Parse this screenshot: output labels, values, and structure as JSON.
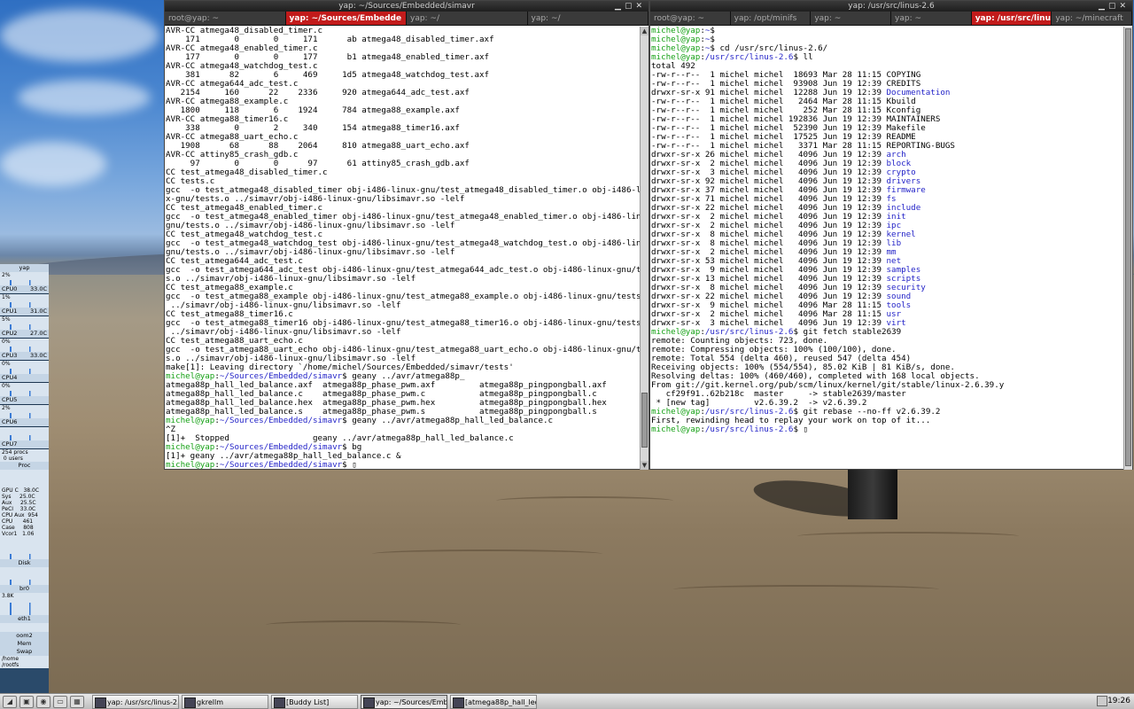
{
  "left_window": {
    "title": "yap: ~/Sources/Embedded/simavr",
    "tabs": [
      {
        "label": "root@yap: ~",
        "active": false
      },
      {
        "label": "yap: ~/Sources/Embedde",
        "active": true
      },
      {
        "label": "yap: ~/",
        "active": false
      },
      {
        "label": "yap: ~/",
        "active": false
      }
    ],
    "lines": [
      "AVR-CC atmega48_disabled_timer.c",
      "    171       0       0     171      ab atmega48_disabled_timer.axf",
      "AVR-CC atmega48_enabled_timer.c",
      "    177       0       0     177      b1 atmega48_enabled_timer.axf",
      "AVR-CC atmega48_watchdog_test.c",
      "    381      82       6     469     1d5 atmega48_watchdog_test.axf",
      "AVR-CC atmega644_adc_test.c",
      "   2154     160      22    2336     920 atmega644_adc_test.axf",
      "AVR-CC atmega88_example.c",
      "   1800     118       6    1924     784 atmega88_example.axf",
      "AVR-CC atmega88_timer16.c",
      "    338       0       2     340     154 atmega88_timer16.axf",
      "AVR-CC atmega88_uart_echo.c",
      "   1908      68      88    2064     810 atmega88_uart_echo.axf",
      "AVR-CC attiny85_crash_gdb.c",
      "     97       0       0      97      61 attiny85_crash_gdb.axf",
      "CC test_atmega48_disabled_timer.c",
      "CC tests.c",
      "gcc  -o test_atmega48_disabled_timer obj-i486-linux-gnu/test_atmega48_disabled_timer.o obj-i486-linu",
      "x-gnu/tests.o ../simavr/obj-i486-linux-gnu/libsimavr.so -lelf",
      "CC test_atmega48_enabled_timer.c",
      "gcc  -o test_atmega48_enabled_timer obj-i486-linux-gnu/test_atmega48_enabled_timer.o obj-i486-linux-",
      "gnu/tests.o ../simavr/obj-i486-linux-gnu/libsimavr.so -lelf",
      "CC test_atmega48_watchdog_test.c",
      "gcc  -o test_atmega48_watchdog_test obj-i486-linux-gnu/test_atmega48_watchdog_test.o obj-i486-linux-",
      "gnu/tests.o ../simavr/obj-i486-linux-gnu/libsimavr.so -lelf",
      "CC test_atmega644_adc_test.c",
      "gcc  -o test_atmega644_adc_test obj-i486-linux-gnu/test_atmega644_adc_test.o obj-i486-linux-gnu/test",
      "s.o ../simavr/obj-i486-linux-gnu/libsimavr.so -lelf",
      "CC test_atmega88_example.c",
      "gcc  -o test_atmega88_example obj-i486-linux-gnu/test_atmega88_example.o obj-i486-linux-gnu/tests.o",
      " ../simavr/obj-i486-linux-gnu/libsimavr.so -lelf",
      "CC test_atmega88_timer16.c",
      "gcc  -o test_atmega88_timer16 obj-i486-linux-gnu/test_atmega88_timer16.o obj-i486-linux-gnu/tests.o",
      " ../simavr/obj-i486-linux-gnu/libsimavr.so -lelf",
      "CC test_atmega88_uart_echo.c",
      "gcc  -o test_atmega88_uart_echo obj-i486-linux-gnu/test_atmega88_uart_echo.o obj-i486-linux-gnu/test",
      "s.o ../simavr/obj-i486-linux-gnu/libsimavr.so -lelf",
      "make[1]: Leaving directory `/home/michel/Sources/Embedded/simavr/tests'"
    ],
    "prompt_user": "michel@yap",
    "prompt_path": "~/Sources/Embedded/simavr",
    "cmd1": "geany ../avr/atmega88p_",
    "listing": [
      "atmega88p_hall_led_balance.axf  atmega88p_phase_pwm.axf         atmega88p_pingpongball.axf",
      "atmega88p_hall_led_balance.c    atmega88p_phase_pwm.c           atmega88p_pingpongball.c",
      "atmega88p_hall_led_balance.hex  atmega88p_phase_pwm.hex         atmega88p_pingpongball.hex",
      "atmega88p_hall_led_balance.s    atmega88p_phase_pwm.s           atmega88p_pingpongball.s"
    ],
    "cmd2": "geany ../avr/atmega88p_hall_led_balance.c",
    "after": [
      "^Z",
      "[1]+  Stopped                 geany ../avr/atmega88p_hall_led_balance.c"
    ],
    "cmd3": "bg",
    "bg_line": "[1]+ geany ../avr/atmega88p_hall_led_balance.c &"
  },
  "right_window": {
    "title": "yap: /usr/src/linus-2.6",
    "tabs": [
      {
        "label": "root@yap: ~",
        "active": false
      },
      {
        "label": "yap: /opt/minifs",
        "active": false
      },
      {
        "label": "yap: ~",
        "active": false
      },
      {
        "label": "yap: ~",
        "active": false
      },
      {
        "label": "yap: /usr/src/linus-2.6",
        "active": true
      },
      {
        "label": "yap: ~/minecraft",
        "active": false
      }
    ],
    "prompt_user": "michel@yap",
    "home_path": "~",
    "src_path": "/usr/src/linus-2.6",
    "cmd_cd": "cd /usr/src/linus-2.6/",
    "cmd_ll": "ll",
    "total": "total 492",
    "files": [
      {
        "meta": "-rw-r--r--  1 michel michel  18693 Mar 28 11:15 ",
        "name": "COPYING",
        "dir": false
      },
      {
        "meta": "-rw-r--r--  1 michel michel  93908 Jun 19 12:39 ",
        "name": "CREDITS",
        "dir": false
      },
      {
        "meta": "drwxr-sr-x 91 michel michel  12288 Jun 19 12:39 ",
        "name": "Documentation",
        "dir": true
      },
      {
        "meta": "-rw-r--r--  1 michel michel   2464 Mar 28 11:15 ",
        "name": "Kbuild",
        "dir": false
      },
      {
        "meta": "-rw-r--r--  1 michel michel    252 Mar 28 11:15 ",
        "name": "Kconfig",
        "dir": false
      },
      {
        "meta": "-rw-r--r--  1 michel michel 192836 Jun 19 12:39 ",
        "name": "MAINTAINERS",
        "dir": false
      },
      {
        "meta": "-rw-r--r--  1 michel michel  52390 Jun 19 12:39 ",
        "name": "Makefile",
        "dir": false
      },
      {
        "meta": "-rw-r--r--  1 michel michel  17525 Jun 19 12:39 ",
        "name": "README",
        "dir": false
      },
      {
        "meta": "-rw-r--r--  1 michel michel   3371 Mar 28 11:15 ",
        "name": "REPORTING-BUGS",
        "dir": false
      },
      {
        "meta": "drwxr-sr-x 26 michel michel   4096 Jun 19 12:39 ",
        "name": "arch",
        "dir": true
      },
      {
        "meta": "drwxr-sr-x  2 michel michel   4096 Jun 19 12:39 ",
        "name": "block",
        "dir": true
      },
      {
        "meta": "drwxr-sr-x  3 michel michel   4096 Jun 19 12:39 ",
        "name": "crypto",
        "dir": true
      },
      {
        "meta": "drwxr-sr-x 92 michel michel   4096 Jun 19 12:39 ",
        "name": "drivers",
        "dir": true
      },
      {
        "meta": "drwxr-sr-x 37 michel michel   4096 Jun 19 12:39 ",
        "name": "firmware",
        "dir": true
      },
      {
        "meta": "drwxr-sr-x 71 michel michel   4096 Jun 19 12:39 ",
        "name": "fs",
        "dir": true
      },
      {
        "meta": "drwxr-sr-x 22 michel michel   4096 Jun 19 12:39 ",
        "name": "include",
        "dir": true
      },
      {
        "meta": "drwxr-sr-x  2 michel michel   4096 Jun 19 12:39 ",
        "name": "init",
        "dir": true
      },
      {
        "meta": "drwxr-sr-x  2 michel michel   4096 Jun 19 12:39 ",
        "name": "ipc",
        "dir": true
      },
      {
        "meta": "drwxr-sr-x  8 michel michel   4096 Jun 19 12:39 ",
        "name": "kernel",
        "dir": true
      },
      {
        "meta": "drwxr-sr-x  8 michel michel   4096 Jun 19 12:39 ",
        "name": "lib",
        "dir": true
      },
      {
        "meta": "drwxr-sr-x  2 michel michel   4096 Jun 19 12:39 ",
        "name": "mm",
        "dir": true
      },
      {
        "meta": "drwxr-sr-x 53 michel michel   4096 Jun 19 12:39 ",
        "name": "net",
        "dir": true
      },
      {
        "meta": "drwxr-sr-x  9 michel michel   4096 Jun 19 12:39 ",
        "name": "samples",
        "dir": true
      },
      {
        "meta": "drwxr-sr-x 13 michel michel   4096 Jun 19 12:39 ",
        "name": "scripts",
        "dir": true
      },
      {
        "meta": "drwxr-sr-x  8 michel michel   4096 Jun 19 12:39 ",
        "name": "security",
        "dir": true
      },
      {
        "meta": "drwxr-sr-x 22 michel michel   4096 Jun 19 12:39 ",
        "name": "sound",
        "dir": true
      },
      {
        "meta": "drwxr-sr-x  9 michel michel   4096 Mar 28 11:15 ",
        "name": "tools",
        "dir": true
      },
      {
        "meta": "drwxr-sr-x  2 michel michel   4096 Mar 28 11:15 ",
        "name": "usr",
        "dir": true
      },
      {
        "meta": "drwxr-sr-x  3 michel michel   4096 Jun 19 12:39 ",
        "name": "virt",
        "dir": true
      }
    ],
    "cmd_fetch": "git fetch stable2639",
    "fetch_out": [
      "remote: Counting objects: 723, done.",
      "remote: Compressing objects: 100% (100/100), done.",
      "remote: Total 554 (delta 460), reused 547 (delta 454)",
      "Receiving objects: 100% (554/554), 85.02 KiB | 81 KiB/s, done.",
      "Resolving deltas: 100% (460/460), completed with 168 local objects.",
      "From git://git.kernel.org/pub/scm/linux/kernel/git/stable/linux-2.6.39.y",
      "   cf29f91..62b218c  master     -> stable2639/master",
      " * [new tag]         v2.6.39.2  -> v2.6.39.2"
    ],
    "cmd_rebase": "git rebase --no-ff v2.6.39.2",
    "rebase_out": "First, rewinding head to replay your work on top of it..."
  },
  "gkrellm": {
    "host": "yap",
    "cpus": [
      {
        "label": "CPU0",
        "pct": "2%",
        "temp": "33.0C"
      },
      {
        "label": "CPU1",
        "pct": "1%",
        "temp": "31.0C"
      },
      {
        "label": "CPU2",
        "pct": "5%",
        "temp": "27.0C"
      },
      {
        "label": "CPU3",
        "pct": "0%",
        "temp": "33.0C"
      },
      {
        "label": "CPU4",
        "pct": "0%",
        "temp": ""
      },
      {
        "label": "CPU5",
        "pct": "0%",
        "temp": ""
      },
      {
        "label": "CPU6",
        "pct": "2%",
        "temp": ""
      },
      {
        "label": "CPU7",
        "pct": "",
        "temp": ""
      }
    ],
    "procs": "254 procs\n 0 users",
    "proc_label": "Proc",
    "sensors": "GPU C   38.0C\nSys     25.0C\nAux     25.5C\nPeCI    33.0C",
    "fans": "CPU Aux  954\nCPU      461\nCase     808",
    "vcore": "Vcor1   1.06",
    "disk_label": "Disk",
    "net_label": "br0",
    "net_rate": "3.8K",
    "eth_label": "eth1",
    "oom_label": "oom2",
    "mem_label": "Mem",
    "swap_label": "Swap",
    "fs_labels": [
      "/home",
      "/rootfs"
    ]
  },
  "taskbar": {
    "tasks": [
      {
        "label": "yap: /usr/src/linus-2.6",
        "active": false
      },
      {
        "label": "gkrellm",
        "active": false
      },
      {
        "label": "[Buddy List]",
        "active": false
      },
      {
        "label": "yap: ~/Sources/Embed...",
        "active": true
      },
      {
        "label": "[atmega88p_hall_led_b...",
        "active": false
      }
    ],
    "clock": "19:26"
  }
}
